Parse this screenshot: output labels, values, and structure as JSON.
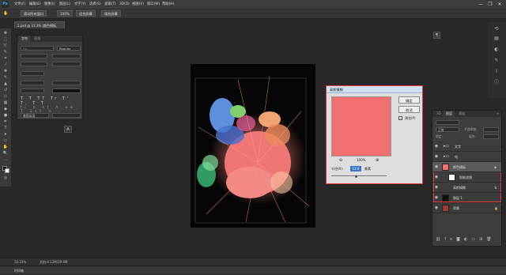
{
  "menubar": {
    "logo": "Ps",
    "items": [
      "文件(F)",
      "编辑(E)",
      "图像(I)",
      "图层(L)",
      "文字(Y)",
      "选择(S)",
      "滤镜(T)",
      "3D(D)",
      "视图(V)",
      "窗口(W)",
      "帮助(H)"
    ],
    "window_controls": [
      "—",
      "❐",
      "✕"
    ]
  },
  "options": {
    "buttons": [
      "滚动所有窗口",
      "100%",
      "适合屏幕",
      "填充屏幕"
    ]
  },
  "document": {
    "tab_label": "2.psd @ 33.3% (颜色模板, RGB/8#) *"
  },
  "character_panel": {
    "tabs": [
      "字符",
      "段落"
    ],
    "font_family": "Aa...",
    "font_style": "Regular",
    "type_styles": [
      "T",
      "T",
      "TT",
      "Tr",
      "T'",
      "T,",
      "T",
      "T"
    ],
    "language": "美国英语"
  },
  "dialog": {
    "title": "高斯模糊",
    "ok": "确定",
    "cancel": "取消",
    "preview_label": "预览(P)",
    "zoom_value": "100%",
    "radius_label": "半径(R):",
    "radius_value": "12.0",
    "unit": "像素"
  },
  "layers": {
    "tabs": [
      "3D",
      "图层",
      "通道"
    ],
    "blend_mode": "正常",
    "opacity_label": "不透明度:",
    "lock_label": "锁定:",
    "fill_label": "填充:",
    "items": [
      "文字",
      "电",
      "颜色模板",
      "智能滤镜",
      "高斯模糊",
      "图层 1",
      "背景"
    ]
  },
  "status": {
    "zoom": "33.33%",
    "doc_info": "文档:4.12M/39.9M"
  },
  "timeline": {
    "label": "时间轴"
  },
  "colors": {
    "coral": "#f16f6f",
    "highlight": "#e23b3b",
    "selected_row": "#5a5a5a"
  }
}
